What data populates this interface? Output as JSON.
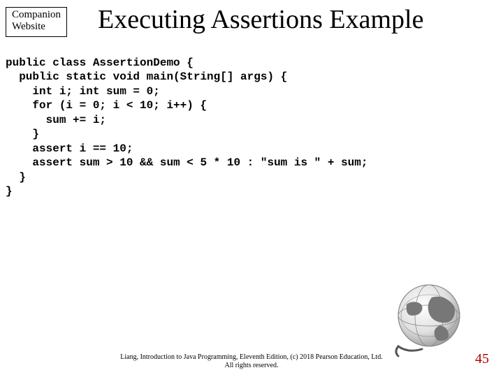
{
  "badge": {
    "line1": "Companion",
    "line2": "Website"
  },
  "title": "Executing Assertions Example",
  "code": "public class AssertionDemo {\n  public static void main(String[] args) {\n    int i; int sum = 0;\n    for (i = 0; i < 10; i++) {\n      sum += i;\n    }\n    assert i == 10;\n    assert sum > 10 && sum < 5 * 10 : \"sum is \" + sum;\n  }\n}",
  "footer": {
    "line1": "Liang, Introduction to Java Programming, Eleventh Edition, (c) 2018 Pearson Education, Ltd.",
    "line2": "All rights reserved."
  },
  "page_number": "45"
}
